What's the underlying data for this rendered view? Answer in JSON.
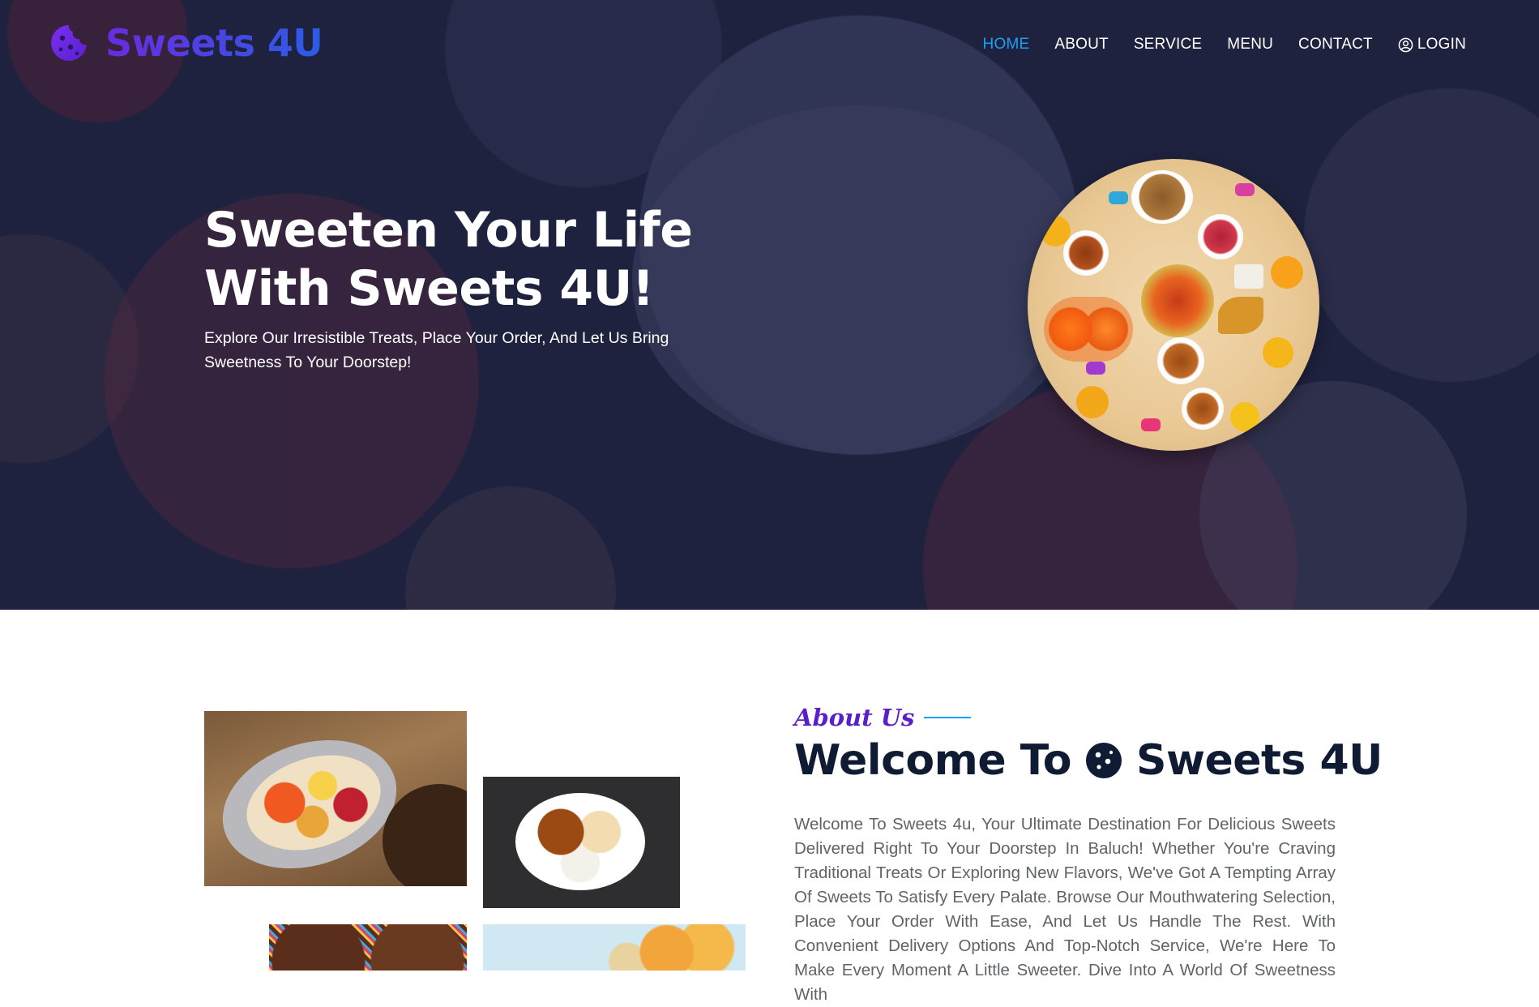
{
  "brand": {
    "name": "Sweets 4U",
    "logo_icon": "cookie-icon"
  },
  "nav": {
    "items": [
      {
        "label": "HOME",
        "active": true
      },
      {
        "label": "ABOUT",
        "active": false
      },
      {
        "label": "SERVICE",
        "active": false
      },
      {
        "label": "MENU",
        "active": false
      },
      {
        "label": "CONTACT",
        "active": false
      }
    ],
    "login": {
      "label": "LOGIN",
      "icon": "user-circle-icon"
    }
  },
  "hero": {
    "title": "Sweeten Your Life With Sweets 4U!",
    "subtitle": "Explore Our Irresistible Treats, Place Your Order, And Let Us Bring Sweetness To Your Doorstep!"
  },
  "about": {
    "label": "About Us",
    "heading_prefix": "Welcome To",
    "heading_suffix": "Sweets 4U",
    "body": "Welcome To Sweets 4u, Your Ultimate Destination For Delicious Sweets Delivered Right To Your Doorstep In Baluch! Whether You're Craving Traditional Treats Or Exploring New Flavors, We've Got A Tempting Array Of Sweets To Satisfy Every Palate. Browse Our Mouthwatering Selection, Place Your Order With Ease, And Let Us Handle The Rest. With Convenient Delivery Options And Top-Notch Service, We're Here To Make Every Moment A Little Sweeter. Dive Into A World Of Sweetness With"
  },
  "colors": {
    "accent": "#1e9ff2",
    "brand": "#5b1fc9",
    "hero_bg": "#262a47"
  }
}
